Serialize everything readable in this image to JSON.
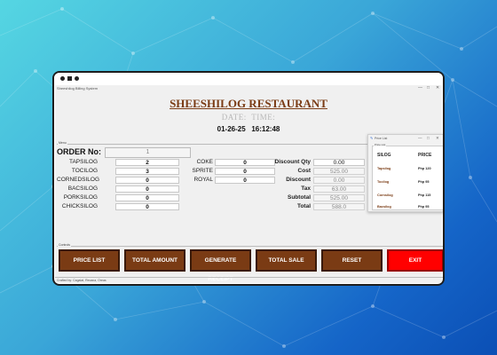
{
  "window": {
    "title": "Sheeshilog Billing System",
    "controls": [
      "—",
      "□",
      "✕"
    ]
  },
  "header": {
    "restaurant_name": "SHEESHILOG RESTAURANT",
    "date_label": "DATE:",
    "time_label": "TIME:",
    "date_value": "01-26-25",
    "time_value": "16:12:48"
  },
  "menu": {
    "frame_label": "Menu",
    "order_no_label": "ORDER No:",
    "order_no_value": "1",
    "silogs": [
      {
        "label": "TAPSILOG",
        "qty": "2"
      },
      {
        "label": "TOCILOG",
        "qty": "3"
      },
      {
        "label": "CORNEDSILOG",
        "qty": "0"
      },
      {
        "label": "BACSILOG",
        "qty": "0"
      },
      {
        "label": "PORKSILOG",
        "qty": "0"
      },
      {
        "label": "CHICKSILOG",
        "qty": "0"
      }
    ],
    "drinks": [
      {
        "label": "COKE",
        "qty": "0"
      },
      {
        "label": "SPRITE",
        "qty": "0"
      },
      {
        "label": "ROYAL",
        "qty": "0"
      }
    ],
    "totals": [
      {
        "label": "Discount Qty",
        "value": "0.00"
      },
      {
        "label": "Cost",
        "value": "525.00"
      },
      {
        "label": "Discount",
        "value": "0.00"
      },
      {
        "label": "Tax",
        "value": "63.00"
      },
      {
        "label": "Subtotal",
        "value": "525.00"
      },
      {
        "label": "Total",
        "value": "588.0"
      }
    ]
  },
  "price_popup": {
    "title": "Price List",
    "frame_label": "Price List",
    "header_silog": "SILOG",
    "header_price": "PRICE",
    "items": [
      {
        "name": "Tapsilog",
        "price": "Php 120"
      },
      {
        "name": "Tocilog",
        "price": "Php 95"
      },
      {
        "name": "Cornsilog",
        "price": "Php 115"
      },
      {
        "name": "Bacsilog",
        "price": "Php 95"
      }
    ]
  },
  "controls": {
    "frame_label": "Controls",
    "buttons": [
      "PRICE LIST",
      "TOTAL AMOUNT",
      "GENERATE RECEIPT",
      "TOTAL SALE",
      "RESET",
      "EXIT"
    ]
  },
  "footer": "Crafted by: Cagalat, Recana, Oreas",
  "colors": {
    "accent_brown": "#7a3b14",
    "exit_red": "#ff0000"
  }
}
